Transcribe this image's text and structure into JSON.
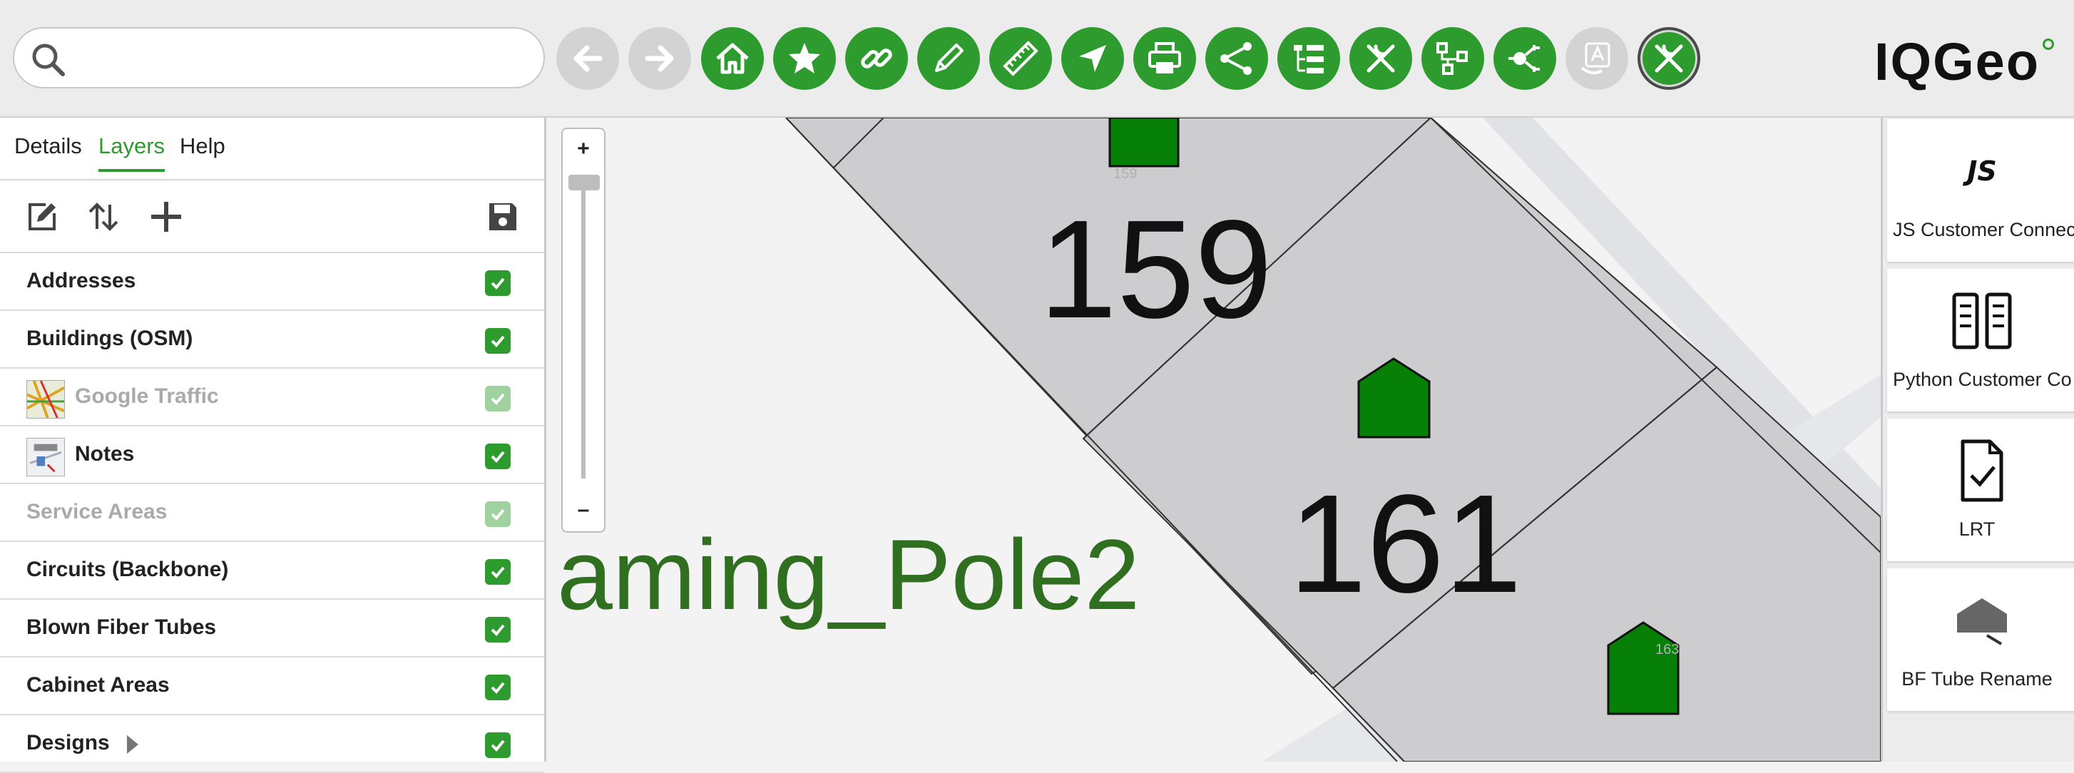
{
  "search": {
    "placeholder": "",
    "value": ""
  },
  "toolbar": {
    "buttons": [
      {
        "name": "back-button",
        "icon": "arrow-left-icon",
        "enabled": false
      },
      {
        "name": "forward-button",
        "icon": "arrow-right-icon",
        "enabled": false
      },
      {
        "name": "home-button",
        "icon": "home-icon",
        "enabled": true
      },
      {
        "name": "bookmark-button",
        "icon": "star-icon",
        "enabled": true
      },
      {
        "name": "link-button",
        "icon": "link-icon",
        "enabled": true
      },
      {
        "name": "edit-button",
        "icon": "pencil-icon",
        "enabled": true
      },
      {
        "name": "measure-button",
        "icon": "ruler-icon",
        "enabled": true
      },
      {
        "name": "navigate-button",
        "icon": "navigate-arrow-icon",
        "enabled": true
      },
      {
        "name": "print-button",
        "icon": "printer-icon",
        "enabled": true
      },
      {
        "name": "share-button",
        "icon": "share-icon",
        "enabled": true
      },
      {
        "name": "tree-button",
        "icon": "hierarchy-list-icon",
        "enabled": true
      },
      {
        "name": "tools-button",
        "icon": "tools-icon",
        "enabled": true
      },
      {
        "name": "network-button",
        "icon": "network-diagram-icon",
        "enabled": true
      },
      {
        "name": "connect-button",
        "icon": "plug-icon",
        "enabled": true
      },
      {
        "name": "translate-button",
        "icon": "translate-icon",
        "enabled": false
      },
      {
        "name": "admin-tools-button",
        "icon": "wrench-screwdriver-icon",
        "enabled": true,
        "active": true
      }
    ]
  },
  "logo": {
    "text": "IQGeo"
  },
  "left_panel": {
    "tabs": [
      {
        "label": "Details",
        "active": false
      },
      {
        "label": "Layers",
        "active": true
      },
      {
        "label": "Help",
        "active": false
      }
    ],
    "layers": [
      {
        "label": "Addresses",
        "checked": true,
        "faded": false
      },
      {
        "label": "Buildings (OSM)",
        "checked": true,
        "faded": false
      },
      {
        "label": "Google Traffic",
        "checked": true,
        "faded": true,
        "icon": "traffic-map-icon"
      },
      {
        "label": "Notes",
        "checked": true,
        "faded": false,
        "icon": "notes-layer-icon"
      },
      {
        "label": "Service Areas",
        "checked": true,
        "faded": true
      },
      {
        "label": "Circuits (Backbone)",
        "checked": true,
        "faded": false
      },
      {
        "label": "Blown Fiber Tubes",
        "checked": true,
        "faded": false
      },
      {
        "label": "Cabinet Areas",
        "checked": true,
        "faded": false
      },
      {
        "label": "Designs",
        "checked": true,
        "faded": false,
        "expandable": true
      }
    ]
  },
  "map": {
    "zoom_in": "+",
    "zoom_out": "–",
    "pole_label": "aming_Pole2",
    "parcels": [
      "159",
      "161"
    ],
    "small_labels": [
      "159",
      "163"
    ],
    "colors": {
      "parcel": "#cdcdcf",
      "feature": "#078007",
      "label": "#2f6f1f"
    }
  },
  "right_panel": {
    "cards": [
      {
        "label": "JS Customer Connect",
        "icon": "js-icon",
        "icon_text": "JS"
      },
      {
        "label": "Python Customer Co",
        "icon": "python-columns-icon"
      },
      {
        "label": "LRT",
        "icon": "document-check-icon"
      },
      {
        "label": "BF Tube Rename",
        "icon": "house-cursor-icon"
      }
    ]
  }
}
